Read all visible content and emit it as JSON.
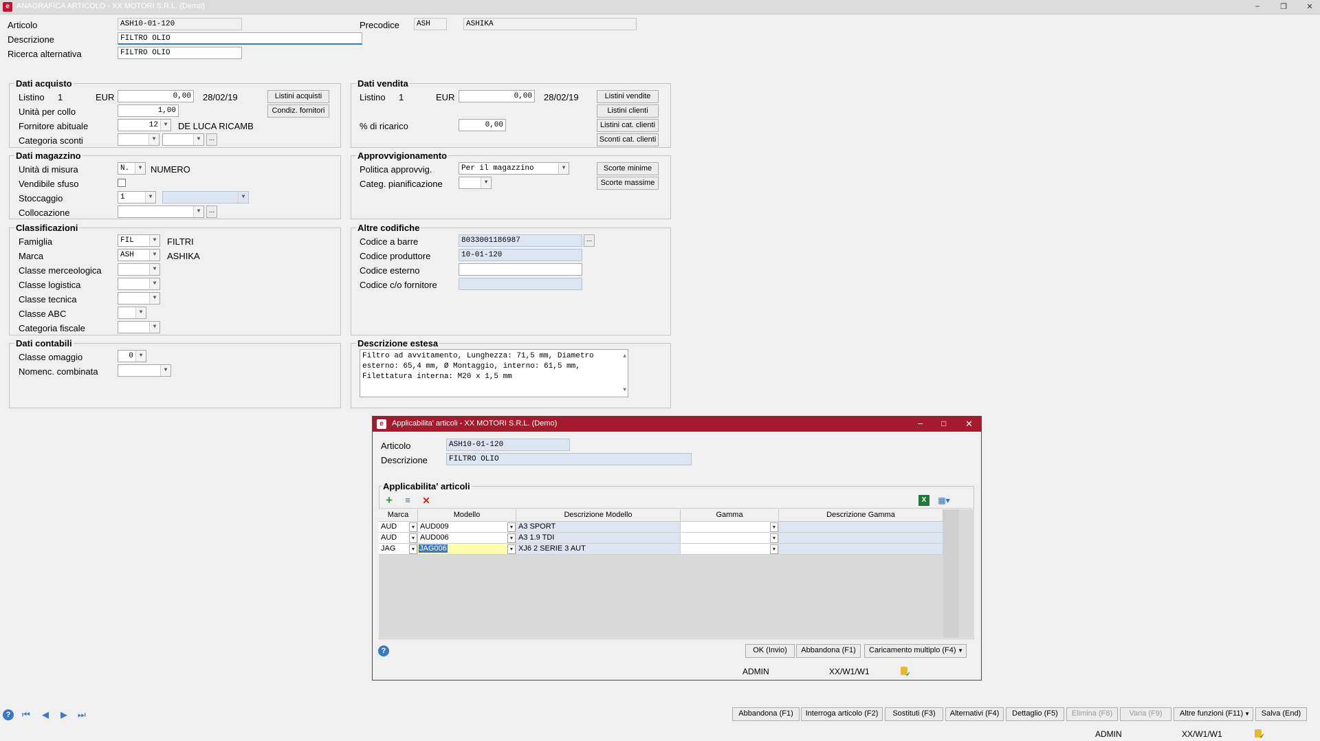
{
  "window": {
    "title": "ANAGRAFICA ARTICOLO - XX  MOTORI S.R.L.  (Demo)"
  },
  "header": {
    "articolo_label": "Articolo",
    "articolo_value": "ASH10-01-120",
    "precodice_label": "Precodice",
    "precodice_value": "ASH",
    "precodice_desc": "ASHIKA",
    "descrizione_label": "Descrizione",
    "descrizione_value": "FILTRO OLIO",
    "ricerca_label": "Ricerca alternativa",
    "ricerca_value": "FILTRO OLIO"
  },
  "acquisto": {
    "title": "Dati acquisto",
    "listino_label": "Listino",
    "listino_num": "1",
    "currency": "EUR",
    "price": "0,00",
    "date": "28/02/19",
    "btn_listini": "Listini acquisti",
    "unita_label": "Unità per collo",
    "unita_value": "1,00",
    "btn_condiz": "Condiz. fornitori",
    "fornitore_label": "Fornitore abituale",
    "fornitore_value": "12",
    "fornitore_desc": "DE LUCA RICAMB",
    "categoria_label": "Categoria sconti",
    "dots": "..."
  },
  "vendita": {
    "title": "Dati vendita",
    "listino_label": "Listino",
    "listino_num": "1",
    "currency": "EUR",
    "price": "0,00",
    "date": "28/02/19",
    "btn_listini_vendite": "Listini vendite",
    "btn_listini_clienti": "Listini clienti",
    "ricarico_label": "% di ricarico",
    "ricarico_value": "0,00",
    "btn_listini_cat": "Listini cat. clienti",
    "btn_sconti_cat": "Sconti cat. clienti"
  },
  "magazzino": {
    "title": "Dati magazzino",
    "um_label": "Unità di misura",
    "um_value": "N.",
    "um_desc": "NUMERO",
    "vendibile_label": "Vendibile sfuso",
    "stoccaggio_label": "Stoccaggio",
    "stoccaggio_value": "1",
    "collocazione_label": "Collocazione",
    "dots": "..."
  },
  "approvvigionamento": {
    "title": "Approvvigionamento",
    "politica_label": "Politica approvvig.",
    "politica_value": "Per il magazzino",
    "categ_label": "Categ. pianificazione",
    "btn_scorte_min": "Scorte minime",
    "btn_scorte_max": "Scorte massime"
  },
  "classificazioni": {
    "title": "Classificazioni",
    "famiglia_label": "Famiglia",
    "famiglia_value": "FIL",
    "famiglia_desc": "FILTRI",
    "marca_label": "Marca",
    "marca_value": "ASH",
    "marca_desc": "ASHIKA",
    "merceologica_label": "Classe merceologica",
    "logistica_label": "Classe logistica",
    "tecnica_label": "Classe tecnica",
    "abc_label": "Classe ABC",
    "fiscale_label": "Categoria fiscale"
  },
  "altre_codifiche": {
    "title": "Altre codifiche",
    "barre_label": "Codice a barre",
    "barre_value": "8033001186987",
    "produttore_label": "Codice produttore",
    "produttore_value": "10-01-120",
    "esterno_label": "Codice esterno",
    "fornitore_label": "Codice c/o fornitore",
    "dots": "..."
  },
  "contabili": {
    "title": "Dati contabili",
    "omaggio_label": "Classe omaggio",
    "omaggio_value": "0",
    "nomenc_label": "Nomenc. combinata"
  },
  "estesa": {
    "title": "Descrizione estesa",
    "text": "Filtro ad avvitamento, Lunghezza: 71,5 mm, Diametro esterno: 65,4 mm, Ø Montaggio, interno: 61,5 mm, Filettatura interna: M20 x 1,5 mm"
  },
  "dialog": {
    "title": "Applicabilita' articoli - XX  MOTORI S.R.L.  (Demo)",
    "articolo_label": "Articolo",
    "articolo_value": "ASH10-01-120",
    "descrizione_label": "Descrizione",
    "descrizione_value": "FILTRO OLIO",
    "group_title": "Applicabilita' articoli",
    "columns": [
      "Marca",
      "Modello",
      "Descrizione Modello",
      "Gamma",
      "Descrizione Gamma"
    ],
    "rows": [
      {
        "marca": "AUD",
        "modello": "AUD009",
        "descrizione": "A3 SPORT",
        "gamma": "",
        "desc_gamma": ""
      },
      {
        "marca": "AUD",
        "modello": "AUD006",
        "descrizione": "A3 1.9 TDI",
        "gamma": "",
        "desc_gamma": ""
      },
      {
        "marca": "JAG",
        "modello": "JAG006",
        "descrizione": "XJ6 2 SERIE 3 AUT",
        "gamma": "",
        "desc_gamma": ""
      }
    ],
    "btn_ok": "OK (Invio)",
    "btn_abbandona": "Abbandona (F1)",
    "btn_caricamento": "Caricamento multiplo (F4)",
    "status_user": "ADMIN",
    "status_path": "XX/W1/W1"
  },
  "footer": {
    "buttons": [
      "Abbandona (F1)",
      "Interroga articolo (F2)",
      "Sostituti (F3)",
      "Alternativi (F4)",
      "Dettaglio (F5)",
      "Elimina (F8)",
      "Varia (F9)",
      "Altre funzioni (F11)",
      "Salva (End)"
    ],
    "status_user": "ADMIN",
    "status_path": "XX/W1/W1"
  }
}
